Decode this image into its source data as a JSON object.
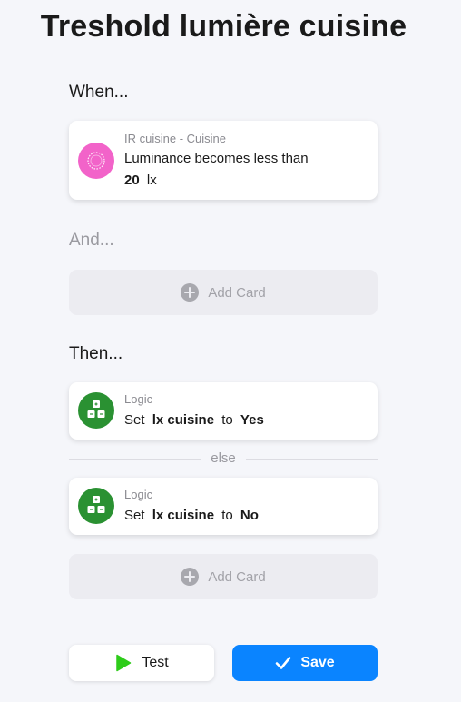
{
  "page": {
    "title": "Treshold lumière cuisine"
  },
  "when": {
    "label": "When...",
    "card": {
      "source": "IR cuisine - Cuisine",
      "text": "Luminance becomes less than",
      "value": "20",
      "unit": "lx",
      "icon": "sensor-icon",
      "icon_color": "#f263c9"
    }
  },
  "and": {
    "label": "And...",
    "add_card_label": "Add Card"
  },
  "then": {
    "label": "Then...",
    "card": {
      "source": "Logic",
      "set_word": "Set",
      "variable": "lx cuisine",
      "to_word": "to",
      "value": "Yes",
      "icon": "logic-icon",
      "icon_color": "#2a9132"
    },
    "else_label": "else",
    "else_card": {
      "source": "Logic",
      "set_word": "Set",
      "variable": "lx cuisine",
      "to_word": "to",
      "value": "No",
      "icon": "logic-icon",
      "icon_color": "#2a9132"
    },
    "add_card_label": "Add Card"
  },
  "actions": {
    "test_label": "Test",
    "save_label": "Save",
    "test_icon_color": "#2ecc1a",
    "save_color": "#0a84ff"
  }
}
